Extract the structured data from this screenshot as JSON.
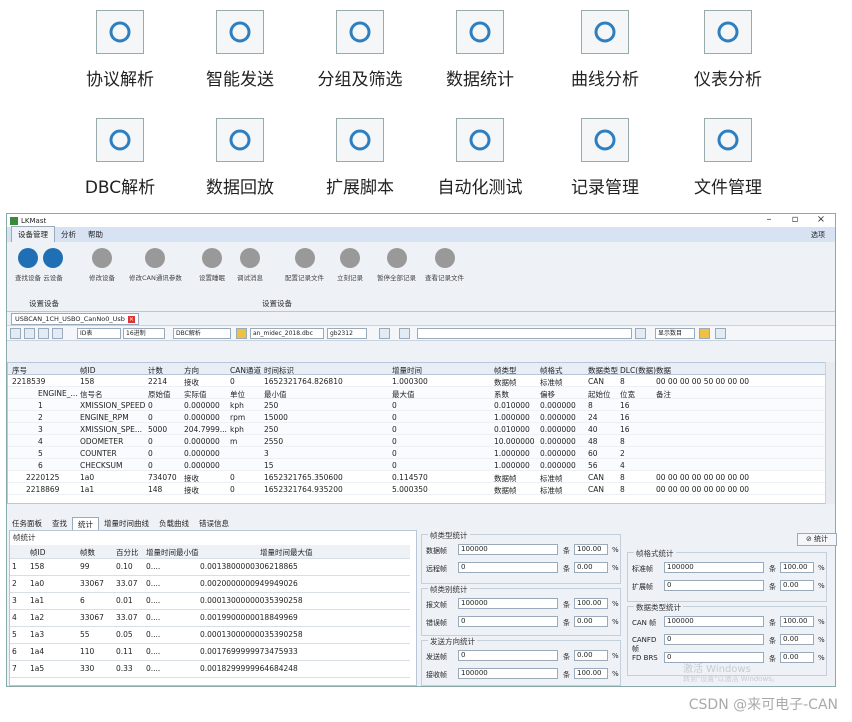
{
  "features": [
    {
      "label": "协议解析",
      "icon": "protocol-icon"
    },
    {
      "label": "智能发送",
      "icon": "send-icon"
    },
    {
      "label": "分组及筛选",
      "icon": "filter-icon"
    },
    {
      "label": "数据统计",
      "icon": "ring-chart-icon"
    },
    {
      "label": "曲线分析",
      "icon": "line-chart-icon"
    },
    {
      "label": "仪表分析",
      "icon": "gauge-icon"
    },
    {
      "label": "DBC解析",
      "icon": "document-search-icon"
    },
    {
      "label": "数据回放",
      "icon": "replay-icon"
    },
    {
      "label": "扩展脚本",
      "icon": "script-icon"
    },
    {
      "label": "自动化测试",
      "icon": "conveyor-icon"
    },
    {
      "label": "记录管理",
      "icon": "download-tray-icon"
    },
    {
      "label": "文件管理",
      "icon": "files-icon"
    }
  ],
  "window": {
    "title": "LKMast",
    "options": "选项"
  },
  "menu": [
    "设备管理",
    "分析",
    "帮助"
  ],
  "ribbon": {
    "buttons": [
      "查找设备",
      "云设备",
      "修改设备",
      "修改CAN通讯参数",
      "设置睡眠",
      "调试消息",
      "配置记录文件",
      "立刻记录",
      "暂停全部记录",
      "查看记录文件"
    ],
    "groups": [
      "设置设备",
      "设置设备"
    ]
  },
  "doc_tab": "USBCAN_1CH_USBO_CanNo0_Usb",
  "toolbar": {
    "mode": "ID表",
    "radix": "16进制",
    "dbc": "DBC解析",
    "dbc_file": "an_midec_2018.dbc",
    "encoding": "gb2312",
    "show_data": "显示数目"
  },
  "grid": {
    "headers": [
      "序号",
      "帧ID",
      "计数",
      "方向",
      "CAN通道",
      "时间标识",
      "增量时间",
      "帧类型",
      "帧格式",
      "数据类型",
      "DLC(数据)",
      "数据"
    ],
    "main_row": [
      "2218539",
      "158",
      "2214",
      "接收",
      "0",
      "1652321764.826810",
      "1.000300",
      "数据帧",
      "标准帧",
      "CAN",
      "8",
      "00 00 00 00 50 00 00 00"
    ],
    "sub_header": [
      "ENGINE_...",
      "信号名",
      "原始值",
      "实际值",
      "单位",
      "最小值",
      "最大值",
      "系数",
      "偏移",
      "起始位",
      "位宽",
      "备注"
    ],
    "signals": [
      [
        "1",
        "XMISSION_SPEED",
        "0",
        "0.000000",
        "kph",
        "250",
        "0",
        "0.010000",
        "0.000000",
        "8",
        "16"
      ],
      [
        "2",
        "ENGINE_RPM",
        "0",
        "0.000000",
        "rpm",
        "15000",
        "0",
        "1.000000",
        "0.000000",
        "24",
        "16"
      ],
      [
        "3",
        "XMISSION_SPE...",
        "5000",
        "204.7999...",
        "kph",
        "250",
        "0",
        "0.010000",
        "0.000000",
        "40",
        "16"
      ],
      [
        "4",
        "ODOMETER",
        "0",
        "0.000000",
        "m",
        "2550",
        "0",
        "10.000000",
        "0.000000",
        "48",
        "8"
      ],
      [
        "5",
        "COUNTER",
        "0",
        "0.000000",
        "",
        "3",
        "0",
        "1.000000",
        "0.000000",
        "60",
        "2"
      ],
      [
        "6",
        "CHECKSUM",
        "0",
        "0.000000",
        "",
        "15",
        "0",
        "1.000000",
        "0.000000",
        "56",
        "4"
      ]
    ],
    "rows": [
      [
        "2220125",
        "1a0",
        "734070",
        "接收",
        "0",
        "1652321765.350600",
        "0.114570",
        "数据帧",
        "标准帧",
        "CAN",
        "8",
        "00 00 00 00 00 00 00 00"
      ],
      [
        "2218869",
        "1a1",
        "148",
        "接收",
        "0",
        "1652321764.935200",
        "5.000350",
        "数据帧",
        "标准帧",
        "CAN",
        "8",
        "00 00 00 00 00 00 00 00"
      ]
    ]
  },
  "panel_tabs": [
    "任务面板",
    "查找",
    "统计",
    "增量时间曲线",
    "负载曲线",
    "错误信息"
  ],
  "frame_stats": {
    "caption": "帧统计",
    "headers": [
      "帧ID",
      "帧数",
      "百分比",
      "增量时间最小值",
      "增量时间最大值"
    ],
    "rows": [
      [
        "1",
        "158",
        "99",
        "0.10",
        "0....",
        "0.0013800000306218865"
      ],
      [
        "2",
        "1a0",
        "33067",
        "33.07",
        "0....",
        "0.0020000000949949026"
      ],
      [
        "3",
        "1a1",
        "6",
        "0.01",
        "0....",
        "0.00013000000035390258"
      ],
      [
        "4",
        "1a2",
        "33067",
        "33.07",
        "0....",
        "0.0019900000018849969"
      ],
      [
        "5",
        "1a3",
        "55",
        "0.05",
        "0....",
        "0.00013000000035390258"
      ],
      [
        "6",
        "1a4",
        "110",
        "0.11",
        "0....",
        "0.0017699999973475933"
      ],
      [
        "7",
        "1a5",
        "330",
        "0.33",
        "0....",
        "0.0018299999964684248"
      ]
    ]
  },
  "frame_type_stats": {
    "title": "帧类型统计",
    "rows": [
      {
        "k": "数据帧",
        "v": "100000",
        "p": "100.00"
      },
      {
        "k": "远程帧",
        "v": "0",
        "p": "0.00"
      }
    ]
  },
  "frame_error_stats": {
    "title": "帧类别统计",
    "rows": [
      {
        "k": "报文帧",
        "v": "100000",
        "p": "100.00"
      },
      {
        "k": "错误帧",
        "v": "0",
        "p": "0.00"
      }
    ]
  },
  "direction_stats": {
    "title": "发送方向统计",
    "rows": [
      {
        "k": "发送帧",
        "v": "0",
        "p": "0.00"
      },
      {
        "k": "接收帧",
        "v": "100000",
        "p": "100.00"
      }
    ]
  },
  "format_stats": {
    "title": "帧格式统计",
    "rows": [
      {
        "k": "标准帧",
        "v": "100000",
        "p": "100.00"
      },
      {
        "k": "扩展帧",
        "v": "0",
        "p": "0.00"
      }
    ]
  },
  "datatype_stats": {
    "title": "数据类型统计",
    "rows": [
      {
        "k": "CAN 帧",
        "v": "100000",
        "p": "100.00"
      },
      {
        "k": "CANFD 帧",
        "v": "0",
        "p": "0.00"
      },
      {
        "k": "FD BRS",
        "v": "0",
        "p": "0.00"
      }
    ]
  },
  "stat_button": "统计",
  "units": {
    "count": "条",
    "percent": "%"
  },
  "watermark": {
    "line1": "激活 Windows",
    "line2": "转到\"设置\"以激活 Windows。"
  },
  "credit": "CSDN @来可电子-CAN"
}
